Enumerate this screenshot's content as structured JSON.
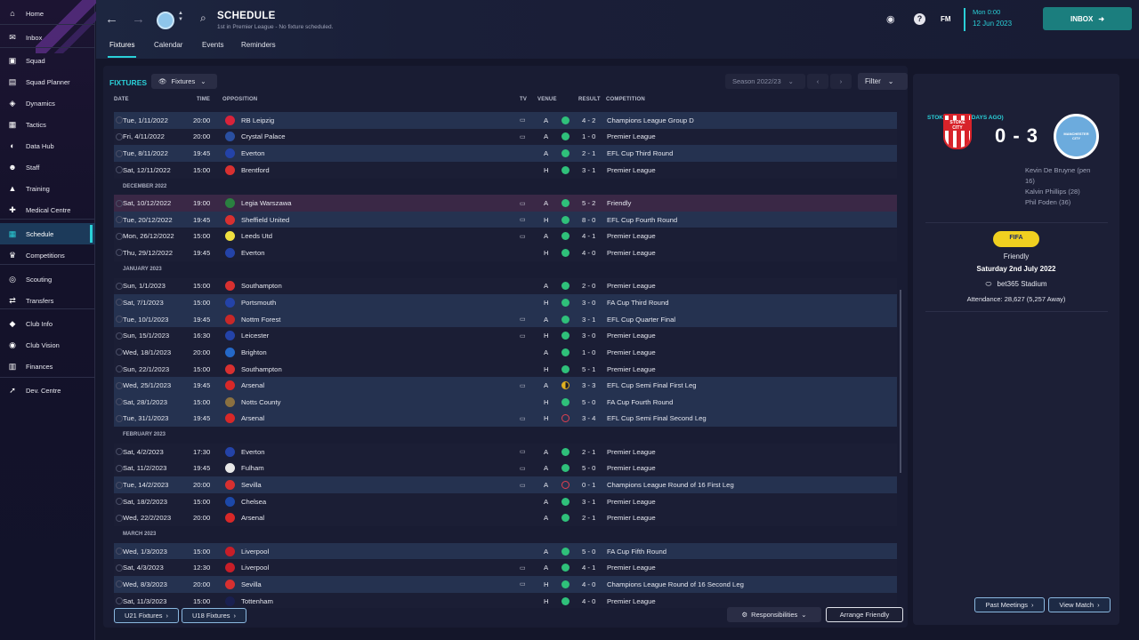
{
  "sidebar": {
    "items": [
      {
        "label": "Home",
        "icon": "home-icon"
      },
      {
        "label": "Inbox",
        "icon": "inbox-icon"
      },
      {
        "label": "Squad",
        "icon": "shirt-icon"
      },
      {
        "label": "Squad Planner",
        "icon": "clipboard-icon"
      },
      {
        "label": "Dynamics",
        "icon": "dynamics-icon"
      },
      {
        "label": "Tactics",
        "icon": "tactics-icon"
      },
      {
        "label": "Data Hub",
        "icon": "data-hub-icon"
      },
      {
        "label": "Staff",
        "icon": "staff-icon"
      },
      {
        "label": "Training",
        "icon": "training-icon"
      },
      {
        "label": "Medical Centre",
        "icon": "medical-icon"
      },
      {
        "label": "Schedule",
        "icon": "calendar-icon"
      },
      {
        "label": "Competitions",
        "icon": "trophy-icon"
      },
      {
        "label": "Scouting",
        "icon": "scouting-icon"
      },
      {
        "label": "Transfers",
        "icon": "transfers-icon"
      },
      {
        "label": "Club Info",
        "icon": "shield-icon"
      },
      {
        "label": "Club Vision",
        "icon": "vision-icon"
      },
      {
        "label": "Finances",
        "icon": "finances-icon"
      },
      {
        "label": "Dev. Centre",
        "icon": "dev-centre-icon"
      }
    ],
    "active_index": 10
  },
  "header": {
    "title": "SCHEDULE",
    "subtitle": "1st in Premier League - No fixture scheduled.",
    "tabs": [
      "Fixtures",
      "Calendar",
      "Events",
      "Reminders"
    ],
    "fm_label": "FM",
    "date_line1": "Mon 0:00",
    "date_line2": "12 Jun 2023",
    "inbox_label": "INBOX"
  },
  "fixtures": {
    "section_label": "FIXTURES",
    "view_dropdown": "Fixtures",
    "season": "Season 2022/23",
    "filter_label": "Filter",
    "columns": [
      "DATE",
      "TIME",
      "OPPOSITION",
      "TV",
      "VENUE",
      "RESULT",
      "COMPETITION"
    ],
    "rows": [
      {
        "kind": "fixture",
        "date": "Tue, 1/11/2022",
        "time": "20:00",
        "opp": "RB Leipzig",
        "badge": "#d8233a",
        "tv": true,
        "venue": "A",
        "result": "win",
        "score": "4 - 2",
        "comp": "Champions League Group D",
        "style": "alt"
      },
      {
        "kind": "fixture",
        "date": "Fri, 4/11/2022",
        "time": "20:00",
        "opp": "Crystal Palace",
        "badge": "#2a4fa0",
        "tv": true,
        "venue": "A",
        "result": "win",
        "score": "1 - 0",
        "comp": "Premier League",
        "style": "plain"
      },
      {
        "kind": "fixture",
        "date": "Tue, 8/11/2022",
        "time": "19:45",
        "opp": "Everton",
        "badge": "#2443a8",
        "tv": false,
        "venue": "A",
        "result": "win",
        "score": "2 - 1",
        "comp": "EFL Cup Third Round",
        "style": "alt"
      },
      {
        "kind": "fixture",
        "date": "Sat, 12/11/2022",
        "time": "15:00",
        "opp": "Brentford",
        "badge": "#d83030",
        "tv": false,
        "venue": "H",
        "result": "win",
        "score": "3 - 1",
        "comp": "Premier League",
        "style": "plain"
      },
      {
        "kind": "month",
        "label": "DECEMBER 2022"
      },
      {
        "kind": "fixture",
        "date": "Sat, 10/12/2022",
        "time": "19:00",
        "opp": "Legia Warszawa",
        "badge": "#2a8040",
        "tv": true,
        "venue": "A",
        "result": "win",
        "score": "5 - 2",
        "comp": "Friendly",
        "style": "hl"
      },
      {
        "kind": "fixture",
        "date": "Tue, 20/12/2022",
        "time": "19:45",
        "opp": "Sheffield United",
        "badge": "#d83030",
        "tv": true,
        "venue": "H",
        "result": "win",
        "score": "8 - 0",
        "comp": "EFL Cup Fourth Round",
        "style": "alt"
      },
      {
        "kind": "fixture",
        "date": "Mon, 26/12/2022",
        "time": "15:00",
        "opp": "Leeds Utd",
        "badge": "#f0e040",
        "tv": true,
        "venue": "A",
        "result": "win",
        "score": "4 - 1",
        "comp": "Premier League",
        "style": "plain"
      },
      {
        "kind": "fixture",
        "date": "Thu, 29/12/2022",
        "time": "19:45",
        "opp": "Everton",
        "badge": "#2443a8",
        "tv": false,
        "venue": "H",
        "result": "win",
        "score": "4 - 0",
        "comp": "Premier League",
        "style": "plain"
      },
      {
        "kind": "month",
        "label": "JANUARY 2023"
      },
      {
        "kind": "fixture",
        "date": "Sun, 1/1/2023",
        "time": "15:00",
        "opp": "Southampton",
        "badge": "#d83030",
        "tv": false,
        "venue": "A",
        "result": "win",
        "score": "2 - 0",
        "comp": "Premier League",
        "style": "plain"
      },
      {
        "kind": "fixture",
        "date": "Sat, 7/1/2023",
        "time": "15:00",
        "opp": "Portsmouth",
        "badge": "#2443a8",
        "tv": false,
        "venue": "H",
        "result": "win",
        "score": "3 - 0",
        "comp": "FA Cup Third Round",
        "style": "alt"
      },
      {
        "kind": "fixture",
        "date": "Tue, 10/1/2023",
        "time": "19:45",
        "opp": "Nottm Forest",
        "badge": "#c82828",
        "tv": true,
        "venue": "A",
        "result": "win",
        "score": "3 - 1",
        "comp": "EFL Cup Quarter Final",
        "style": "alt"
      },
      {
        "kind": "fixture",
        "date": "Sun, 15/1/2023",
        "time": "16:30",
        "opp": "Leicester",
        "badge": "#2443a8",
        "tv": true,
        "venue": "H",
        "result": "win",
        "score": "3 - 0",
        "comp": "Premier League",
        "style": "plain"
      },
      {
        "kind": "fixture",
        "date": "Wed, 18/1/2023",
        "time": "20:00",
        "opp": "Brighton",
        "badge": "#2468c8",
        "tv": false,
        "venue": "A",
        "result": "win",
        "score": "1 - 0",
        "comp": "Premier League",
        "style": "plain"
      },
      {
        "kind": "fixture",
        "date": "Sun, 22/1/2023",
        "time": "15:00",
        "opp": "Southampton",
        "badge": "#d83030",
        "tv": false,
        "venue": "H",
        "result": "win",
        "score": "5 - 1",
        "comp": "Premier League",
        "style": "plain"
      },
      {
        "kind": "fixture",
        "date": "Wed, 25/1/2023",
        "time": "19:45",
        "opp": "Arsenal",
        "badge": "#d82828",
        "tv": true,
        "venue": "A",
        "result": "draw",
        "score": "3 - 3",
        "comp": "EFL Cup Semi Final First Leg",
        "style": "alt"
      },
      {
        "kind": "fixture",
        "date": "Sat, 28/1/2023",
        "time": "15:00",
        "opp": "Notts County",
        "badge": "#8a7040",
        "tv": false,
        "venue": "H",
        "result": "win",
        "score": "5 - 0",
        "comp": "FA Cup Fourth Round",
        "style": "alt"
      },
      {
        "kind": "fixture",
        "date": "Tue, 31/1/2023",
        "time": "19:45",
        "opp": "Arsenal",
        "badge": "#d82828",
        "tv": true,
        "venue": "H",
        "result": "loss",
        "score": "3 - 4",
        "comp": "EFL Cup Semi Final Second Leg",
        "style": "alt"
      },
      {
        "kind": "month",
        "label": "FEBRUARY 2023"
      },
      {
        "kind": "fixture",
        "date": "Sat, 4/2/2023",
        "time": "17:30",
        "opp": "Everton",
        "badge": "#2443a8",
        "tv": true,
        "venue": "A",
        "result": "win",
        "score": "2 - 1",
        "comp": "Premier League",
        "style": "plain"
      },
      {
        "kind": "fixture",
        "date": "Sat, 11/2/2023",
        "time": "19:45",
        "opp": "Fulham",
        "badge": "#e8e8e8",
        "tv": true,
        "venue": "A",
        "result": "win",
        "score": "5 - 0",
        "comp": "Premier League",
        "style": "plain"
      },
      {
        "kind": "fixture",
        "date": "Tue, 14/2/2023",
        "time": "20:00",
        "opp": "Sevilla",
        "badge": "#d83030",
        "tv": true,
        "venue": "A",
        "result": "loss",
        "score": "0 - 1",
        "comp": "Champions League Round of 16  First Leg",
        "style": "alt"
      },
      {
        "kind": "fixture",
        "date": "Sat, 18/2/2023",
        "time": "15:00",
        "opp": "Chelsea",
        "badge": "#1c48a8",
        "tv": false,
        "venue": "A",
        "result": "win",
        "score": "3 - 1",
        "comp": "Premier League",
        "style": "plain"
      },
      {
        "kind": "fixture",
        "date": "Wed, 22/2/2023",
        "time": "20:00",
        "opp": "Arsenal",
        "badge": "#d82828",
        "tv": false,
        "venue": "A",
        "result": "win",
        "score": "2 - 1",
        "comp": "Premier League",
        "style": "plain"
      },
      {
        "kind": "month",
        "label": "MARCH 2023"
      },
      {
        "kind": "fixture",
        "date": "Wed, 1/3/2023",
        "time": "15:00",
        "opp": "Liverpool",
        "badge": "#c81e28",
        "tv": false,
        "venue": "A",
        "result": "win",
        "score": "5 - 0",
        "comp": "FA Cup Fifth Round",
        "style": "alt"
      },
      {
        "kind": "fixture",
        "date": "Sat, 4/3/2023",
        "time": "12:30",
        "opp": "Liverpool",
        "badge": "#c81e28",
        "tv": true,
        "venue": "A",
        "result": "win",
        "score": "4 - 1",
        "comp": "Premier League",
        "style": "plain"
      },
      {
        "kind": "fixture",
        "date": "Wed, 8/3/2023",
        "time": "20:00",
        "opp": "Sevilla",
        "badge": "#d83030",
        "tv": true,
        "venue": "H",
        "result": "win",
        "score": "4 - 0",
        "comp": "Champions League Round of 16  Second Leg",
        "style": "alt"
      },
      {
        "kind": "fixture",
        "date": "Sat, 11/3/2023",
        "time": "15:00",
        "opp": "Tottenham",
        "badge": "#1a2050",
        "tv": false,
        "venue": "H",
        "result": "win",
        "score": "4 - 0",
        "comp": "Premier League",
        "style": "plain"
      }
    ],
    "u21_label": "U21 Fixtures",
    "u18_label": "U18 Fixtures",
    "responsibilities_label": "Responsibilities",
    "arrange_label": "Arrange Friendly"
  },
  "match_panel": {
    "title": "STOKE (A) (345 DAYS AGO)",
    "score": "0 - 3",
    "home_crest_text": "STOKE CITY",
    "away_crest_text": "MANCHESTER CITY",
    "scorers": [
      "Kevin De Bruyne (pen",
      "16)",
      "Kalvin Phillips (28)",
      "Phil Foden (36)"
    ],
    "fifa_badge": "FIFA",
    "competition": "Friendly",
    "date": "Saturday 2nd July 2022",
    "stadium": "bet365 Stadium",
    "attendance": "Attendance: 28,627 (5,257 Away)",
    "past_meetings_label": "Past Meetings",
    "view_match_label": "View Match"
  },
  "colors": {
    "accent": "#2ad0d8",
    "win": "#2fc07a",
    "draw": "#e0b020",
    "loss": "#e04050"
  }
}
